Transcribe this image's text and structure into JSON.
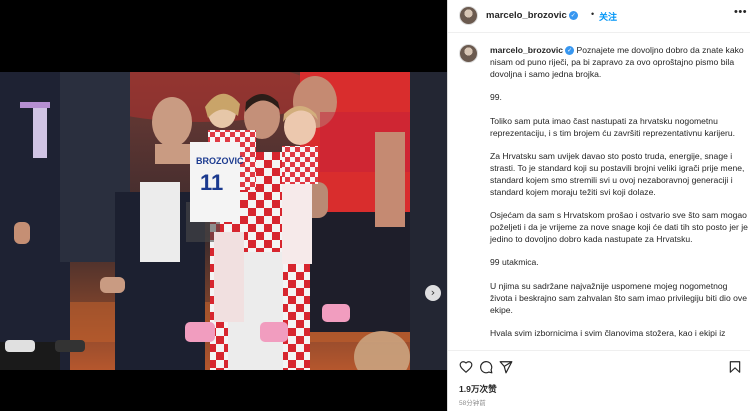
{
  "post": {
    "username": "marcelo_brozovic",
    "separator": "•",
    "follow_label": "关注",
    "more_icon": "more-horizontal-icon"
  },
  "caption": {
    "username": "marcelo_brozovic",
    "paragraphs": [
      "Poznajete me dovoljno dobro da znate kako nisam od puno riječi, pa bi zapravo za ovo oproštajno pismo bila dovoljna i samo jedna brojka.",
      "99.",
      "Toliko sam puta imao čast nastupati za hrvatsku nogometnu reprezentaciju, i s tim brojem ću završiti reprezentativnu karijeru.",
      "Za Hrvatsku sam uvijek davao sto posto truda, energije, snage i strasti. To je standard koji su postavili brojni veliki igrači prije mene, standard kojem smo stremili svi u ovoj nezaboravnoj generaciji i standard kojem moraju težiti svi koji dolaze.",
      "Osjećam da sam s Hrvatskom prošao i ostvario sve što sam mogao poželjeti i da je vrijeme za nove snage koji će dati tih sto posto jer je jedino to dovoljno dobro kada nastupate za Hrvatsku.",
      "99 utakmica.",
      "U njima su sadržane najvažnije uspomene mojeg nogometnog života i beskrajno sam zahvalan što sam imao privilegiju biti dio ove ekipe.",
      "Hvala svim izbornicima i svim članovima stožera, kao i ekipi iz"
    ]
  },
  "actions": {
    "like_icon": "heart-icon",
    "comment_icon": "comment-icon",
    "share_icon": "share-icon",
    "save_icon": "bookmark-icon"
  },
  "stats": {
    "likes": "1.9万次赞",
    "time": "58分钟前"
  },
  "media": {
    "jersey_name": "BROZOVIĆ",
    "jersey_number": "11"
  },
  "colors": {
    "link": "#0095f6",
    "verified": "#3897f0",
    "croatia_red": "#d7262f"
  }
}
